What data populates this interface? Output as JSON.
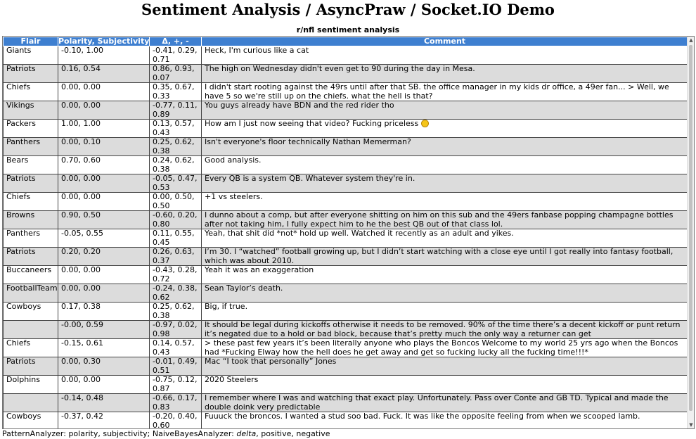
{
  "page": {
    "title": "Sentiment Analysis / AsyncPraw / Socket.IO Demo",
    "section_title": "r/nfl sentiment analysis"
  },
  "table": {
    "headers": {
      "flair": "Flair",
      "polarity": "Polarity, Subjectivity",
      "naive_bayes": "Δ, +, -",
      "comment": "Comment"
    },
    "rows": [
      {
        "flair": "Giants",
        "polarity": "-0.10, 1.00",
        "nb": "-0.41, 0.29, 0.71",
        "comment": "Heck, I'm curious like a cat"
      },
      {
        "flair": "Patriots",
        "polarity": "0.16, 0.54",
        "nb": "0.86, 0.93, 0.07",
        "comment": "The high on Wednesday didn't even get to 90 during the day in Mesa."
      },
      {
        "flair": "Chiefs",
        "polarity": "0.00, 0.00",
        "nb": "0.35, 0.67, 0.33",
        "comment": "I didn't start rooting against the 49rs until after that SB. the office manager in my kids dr office, a 49er fan... > Well, we have 5 so we're still up on the chiefs. what the hell is that?"
      },
      {
        "flair": "Vikings",
        "polarity": "0.00, 0.00",
        "nb": "-0.77, 0.11, 0.89",
        "comment": "You guys already have BDN and the red rider tho"
      },
      {
        "flair": "Packers",
        "polarity": "1.00, 1.00",
        "nb": "0.13, 0.57, 0.43",
        "comment": "How am I just now seeing that video? Fucking priceless",
        "emoji": true
      },
      {
        "flair": "Panthers",
        "polarity": "0.00, 0.10",
        "nb": "0.25, 0.62, 0.38",
        "comment": "Isn't everyone's floor technically Nathan Memerman?"
      },
      {
        "flair": "Bears",
        "polarity": "0.70, 0.60",
        "nb": "0.24, 0.62, 0.38",
        "comment": "Good analysis."
      },
      {
        "flair": "Patriots",
        "polarity": "0.00, 0.00",
        "nb": "-0.05, 0.47, 0.53",
        "comment": "Every QB is a system QB. Whatever system they're in."
      },
      {
        "flair": "Chiefs",
        "polarity": "0.00, 0.00",
        "nb": "0.00, 0.50, 0.50",
        "comment": "+1 vs steelers."
      },
      {
        "flair": "Browns",
        "polarity": "0.90, 0.50",
        "nb": "-0.60, 0.20, 0.80",
        "comment": "I dunno about a comp, but after everyone shitting on him on this sub and the 49ers fanbase popping champagne bottles after not taking him, I fully expect him to he the best QB out of that class lol."
      },
      {
        "flair": "Panthers",
        "polarity": "-0.05, 0.55",
        "nb": "0.11, 0.55, 0.45",
        "comment": "Yeah, that shit did *not* hold up well. Watched it recently as an adult and yikes."
      },
      {
        "flair": "Patriots",
        "polarity": "0.20, 0.20",
        "nb": "0.26, 0.63, 0.37",
        "comment": "I’m 30. I “watched” football growing up, but I didn’t start watching with a close eye until I got really into fantasy football, which was about 2010."
      },
      {
        "flair": "Buccaneers",
        "polarity": "0.00, 0.00",
        "nb": "-0.43, 0.28, 0.72",
        "comment": "Yeah it was an exaggeration"
      },
      {
        "flair": "FootballTeam",
        "polarity": "0.00, 0.00",
        "nb": "-0.24, 0.38, 0.62",
        "comment": "Sean Taylor’s death."
      },
      {
        "flair": "Cowboys",
        "polarity": "0.17, 0.38",
        "nb": "0.25, 0.62, 0.38",
        "comment": "Big, if true."
      },
      {
        "flair": "",
        "polarity": "-0.00, 0.59",
        "nb": "-0.97, 0.02, 0.98",
        "comment": "It should be legal during kickoffs otherwise it needs to be removed. 90% of the time there’s a decent kickoff or punt return it’s negated due to a hold or bad block, because that’s pretty much the only way a returner can get"
      },
      {
        "flair": "Chiefs",
        "polarity": "-0.15, 0.61",
        "nb": "0.14, 0.57, 0.43",
        "comment": "> these past few years it’s been literally anyone who plays the Boncos Welcome to my world 25 yrs ago when the Boncos had *Fucking Elway how the hell does he get away and get so fucking lucky all the fucking time!!!*"
      },
      {
        "flair": "Patriots",
        "polarity": "0.00, 0.30",
        "nb": "-0.01, 0.49, 0.51",
        "comment": "Mac “I took that personally” Jones"
      },
      {
        "flair": "Dolphins",
        "polarity": "0.00, 0.00",
        "nb": "-0.75, 0.12, 0.87",
        "comment": "2020 Steelers"
      },
      {
        "flair": "",
        "polarity": "-0.14, 0.48",
        "nb": "-0.66, 0.17, 0.83",
        "comment": "I remember where I was and watching that exact play. Unfortunately. Pass over Conte and GB TD. Typical and made the double doink very predictable"
      },
      {
        "flair": "Cowboys",
        "polarity": "-0.37, 0.42",
        "nb": "-0.20, 0.40, 0.60",
        "comment": "Fuuuck the broncos. I wanted a stud soo bad. Fuck. It was like the opposite feeling from when we scooped lamb."
      }
    ]
  },
  "footer": {
    "prefix": "PatternAnalyzer: polarity, subjectivity; NaiveBayesAnalyzer: ",
    "delta": "delta",
    "suffix": ", positive, negative"
  },
  "colors": {
    "header_bg": "#3e7fd0",
    "row_alt_bg": "#dcdcdc"
  },
  "icons": {
    "emoji": "grinning-face-emoji"
  }
}
